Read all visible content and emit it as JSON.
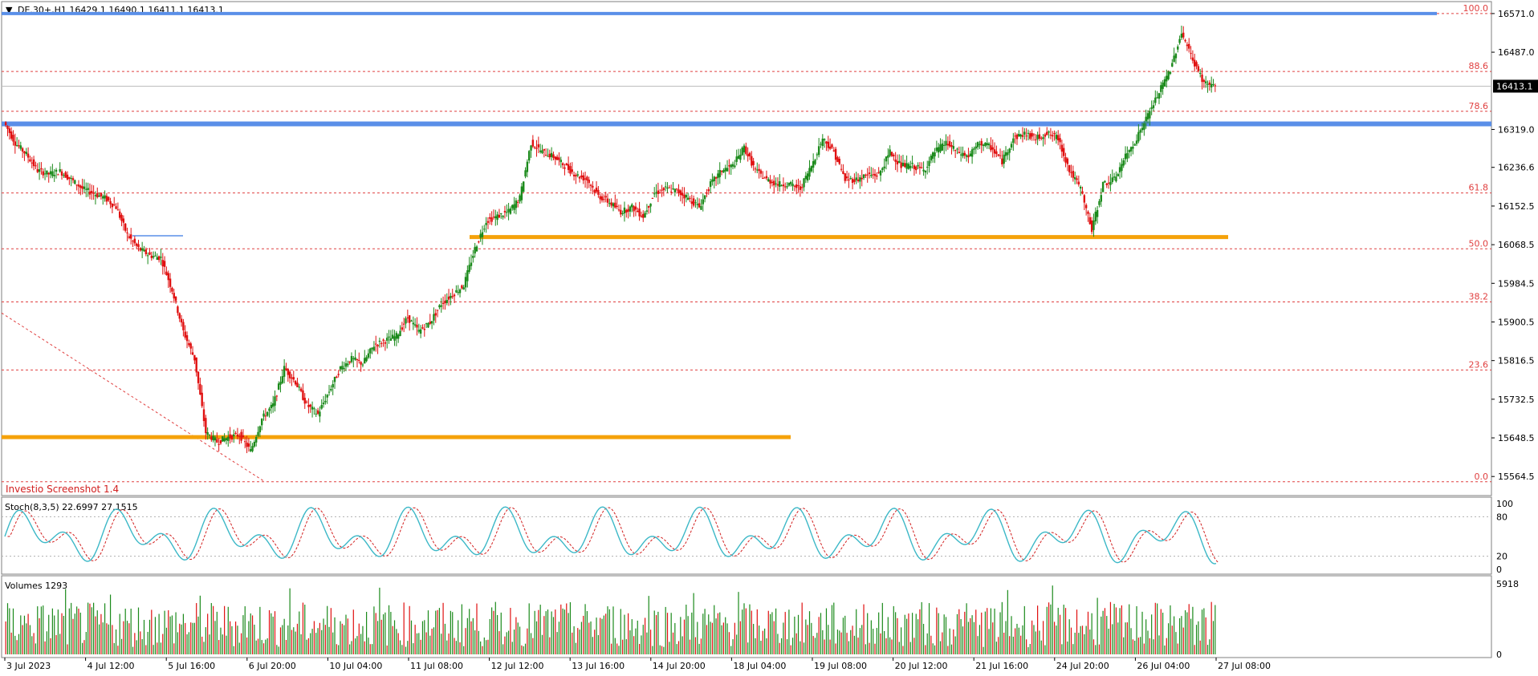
{
  "header": {
    "symbol_line": "DE.30+,H1  16429.1 16490.1 16411.1 16413.1"
  },
  "watermark": "Investio Screenshot 1.4",
  "price_axis": {
    "ticks": [
      "16571.0",
      "16487.0",
      "16319.0",
      "16236.6",
      "16152.5",
      "16068.5",
      "15984.5",
      "15900.5",
      "15816.5",
      "15732.5",
      "15648.5",
      "15564.5"
    ],
    "current_price_label": "16413.1",
    "current_price": 16413.1
  },
  "fib_levels": [
    {
      "label": "100.0",
      "value": 16571.0
    },
    {
      "label": "88.6",
      "value": 16445.0
    },
    {
      "label": "78.6",
      "value": 16358.5
    },
    {
      "label": "61.8",
      "value": 16181.0
    },
    {
      "label": "50.0",
      "value": 16059.5
    },
    {
      "label": "38.2",
      "value": 15944.0
    },
    {
      "label": "23.6",
      "value": 15796.0
    },
    {
      "label": "0.0",
      "value": 15553.0
    }
  ],
  "indicators": {
    "stoch": {
      "label": "Stoch(8,3,5) 22.6997 27.1515",
      "levels": [
        {
          "label": "100",
          "value": 100
        },
        {
          "label": "80",
          "value": 80
        },
        {
          "label": "20",
          "value": 20
        },
        {
          "label": "0",
          "value": 0
        }
      ],
      "main_color": "#3cb8c7",
      "signal_color": "#d22020"
    },
    "volumes": {
      "label": "Volumes 1293",
      "max_label": "5918",
      "zero_label": "0",
      "max_value": 5918
    }
  },
  "time_axis": {
    "labels": [
      "3 Jul 2023",
      "4 Jul 12:00",
      "5 Jul 16:00",
      "6 Jul 20:00",
      "10 Jul 04:00",
      "11 Jul 08:00",
      "12 Jul 12:00",
      "13 Jul 16:00",
      "14 Jul 20:00",
      "18 Jul 04:00",
      "19 Jul 08:00",
      "20 Jul 12:00",
      "21 Jul 16:00",
      "24 Jul 20:00",
      "26 Jul 04:00",
      "27 Jul 08:00"
    ]
  },
  "colors": {
    "bull": "#1b8a1b",
    "bear": "#e01010",
    "support_orange": "#f5a20a",
    "resistance_blue": "#5a8fe8",
    "fib_red": "#e04040"
  },
  "chart_data": [
    {
      "type": "candlestick",
      "title": "DE.30+,H1",
      "ylim": [
        15530,
        16590
      ],
      "last_ohlc": {
        "open": 16429.1,
        "high": 16490.1,
        "low": 16411.1,
        "close": 16413.1
      },
      "x_labels": [
        "3 Jul 2023",
        "4 Jul 12:00",
        "5 Jul 16:00",
        "6 Jul 20:00",
        "10 Jul 04:00",
        "11 Jul 08:00",
        "12 Jul 12:00",
        "13 Jul 16:00",
        "14 Jul 20:00",
        "18 Jul 04:00",
        "19 Jul 08:00",
        "20 Jul 12:00",
        "21 Jul 16:00",
        "24 Jul 20:00",
        "26 Jul 04:00",
        "27 Jul 08:00"
      ],
      "price_path": [
        [
          0,
          16335
        ],
        [
          6,
          16290
        ],
        [
          12,
          16265
        ],
        [
          18,
          16230
        ],
        [
          24,
          16222
        ],
        [
          30,
          16228
        ],
        [
          36,
          16210
        ],
        [
          42,
          16190
        ],
        [
          48,
          16180
        ],
        [
          54,
          16170
        ],
        [
          60,
          16150
        ],
        [
          66,
          16090
        ],
        [
          72,
          16060
        ],
        [
          78,
          16045
        ],
        [
          84,
          16040
        ],
        [
          90,
          15970
        ],
        [
          96,
          15880
        ],
        [
          102,
          15820
        ],
        [
          108,
          15660
        ],
        [
          114,
          15640
        ],
        [
          120,
          15650
        ],
        [
          126,
          15655
        ],
        [
          132,
          15620
        ],
        [
          138,
          15690
        ],
        [
          144,
          15720
        ],
        [
          150,
          15800
        ],
        [
          156,
          15770
        ],
        [
          162,
          15720
        ],
        [
          168,
          15700
        ],
        [
          174,
          15750
        ],
        [
          180,
          15800
        ],
        [
          186,
          15820
        ],
        [
          192,
          15810
        ],
        [
          198,
          15850
        ],
        [
          204,
          15860
        ],
        [
          210,
          15870
        ],
        [
          216,
          15910
        ],
        [
          222,
          15880
        ],
        [
          228,
          15900
        ],
        [
          234,
          15940
        ],
        [
          240,
          15960
        ],
        [
          246,
          15980
        ],
        [
          252,
          16060
        ],
        [
          258,
          16120
        ],
        [
          264,
          16130
        ],
        [
          270,
          16140
        ],
        [
          276,
          16170
        ],
        [
          282,
          16290
        ],
        [
          288,
          16270
        ],
        [
          294,
          16260
        ],
        [
          300,
          16240
        ],
        [
          306,
          16220
        ],
        [
          312,
          16210
        ],
        [
          318,
          16175
        ],
        [
          324,
          16160
        ],
        [
          330,
          16140
        ],
        [
          336,
          16150
        ],
        [
          342,
          16130
        ],
        [
          348,
          16180
        ],
        [
          354,
          16190
        ],
        [
          360,
          16185
        ],
        [
          366,
          16170
        ],
        [
          372,
          16150
        ],
        [
          378,
          16200
        ],
        [
          384,
          16230
        ],
        [
          390,
          16240
        ],
        [
          396,
          16280
        ],
        [
          402,
          16230
        ],
        [
          408,
          16210
        ],
        [
          414,
          16200
        ],
        [
          420,
          16200
        ],
        [
          426,
          16190
        ],
        [
          432,
          16240
        ],
        [
          438,
          16300
        ],
        [
          444,
          16270
        ],
        [
          450,
          16210
        ],
        [
          456,
          16210
        ],
        [
          462,
          16220
        ],
        [
          468,
          16220
        ],
        [
          474,
          16270
        ],
        [
          480,
          16240
        ],
        [
          486,
          16240
        ],
        [
          492,
          16230
        ],
        [
          498,
          16270
        ],
        [
          504,
          16290
        ],
        [
          510,
          16270
        ],
        [
          516,
          16260
        ],
        [
          522,
          16290
        ],
        [
          528,
          16280
        ],
        [
          534,
          16250
        ],
        [
          540,
          16300
        ],
        [
          546,
          16310
        ],
        [
          552,
          16300
        ],
        [
          558,
          16310
        ],
        [
          564,
          16300
        ],
        [
          570,
          16230
        ],
        [
          576,
          16190
        ],
        [
          582,
          16100
        ],
        [
          588,
          16200
        ],
        [
          594,
          16210
        ],
        [
          600,
          16260
        ],
        [
          606,
          16300
        ],
        [
          612,
          16350
        ],
        [
          618,
          16400
        ],
        [
          624,
          16450
        ],
        [
          630,
          16530
        ],
        [
          636,
          16470
        ],
        [
          642,
          16420
        ],
        [
          648,
          16414
        ]
      ],
      "volume_max": 5918,
      "volume_last": 1293,
      "stoch_main_last": 22.6997,
      "stoch_signal_last": 27.1515
    }
  ]
}
